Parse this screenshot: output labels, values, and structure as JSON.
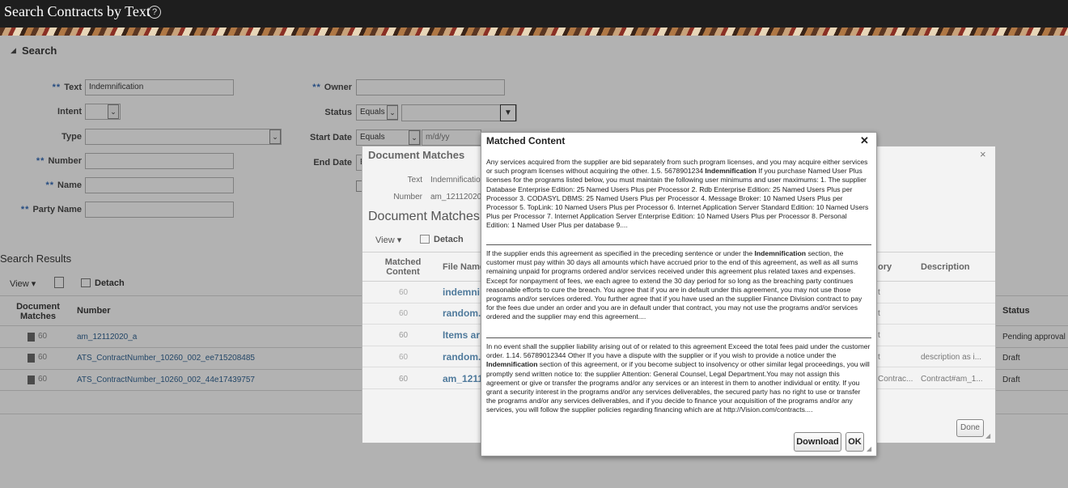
{
  "header": {
    "title": "Search Contracts by Text",
    "help_icon": "?"
  },
  "search": {
    "section_title": "Search",
    "req_marker": "**",
    "text_label": "Text",
    "text_value": "Indemnification",
    "intent_label": "Intent",
    "type_label": "Type",
    "number_label": "Number",
    "name_label": "Name",
    "party_label": "Party Name",
    "owner_label": "Owner",
    "status_label": "Status",
    "status_op": "Equals",
    "start_label": "Start Date",
    "start_op": "Equals",
    "start_placeholder": "m/d/yy",
    "end_label": "End Date",
    "end_op_partial": "E"
  },
  "results": {
    "title": "Search Results",
    "view_label": "View",
    "detach_label": "Detach",
    "col_doc_matches": "Document Matches",
    "col_number": "Number",
    "col_status": "Status",
    "rows": [
      {
        "number": "am_12112020_a",
        "status": "Pending approval"
      },
      {
        "number": "ATS_ContractNumber_10260_002_ee715208485",
        "status": "Draft"
      },
      {
        "number": "ATS_ContractNumber_10260_002_44e17439757",
        "status": "Draft"
      }
    ]
  },
  "doc_dialog": {
    "title": "Document Matches",
    "text_label": "Text",
    "text_value": "Indemnification",
    "number_label": "Number",
    "number_value": "am_12112020_",
    "sub_title": "Document Matches",
    "view_label": "View",
    "detach_label": "Detach",
    "col_matched": "Matched Content",
    "col_file": "File Name",
    "col_category_partial": "ory",
    "col_description": "Description",
    "rows": [
      {
        "file": "indemni",
        "cat": "t",
        "desc": ""
      },
      {
        "file": "random.",
        "cat": "t",
        "desc": ""
      },
      {
        "file": "Items ar",
        "cat": "t",
        "desc": ""
      },
      {
        "file": "random.",
        "cat": "t",
        "desc": "description as i..."
      },
      {
        "file": "am_1211",
        "cat": "Contrac...",
        "desc": "Contract#am_1..."
      }
    ],
    "done_label": "Done"
  },
  "match_dialog": {
    "title": "Matched Content",
    "close_icon": "✕",
    "paragraphs": [
      {
        "before": "Any services acquired from the supplier are bid separately from such program licenses, and you may acquire either services or such program licenses without acquiring the other. 1.5. 5678901234 ",
        "bold": "Indemnification",
        "after": " If you purchase Named User Plus licenses for the programs listed below, you must maintain the following user minimums and user maximums: 1. The supplier Database Enterprise Edition: 25 Named Users Plus per Processor 2. Rdb Enterprise Edition: 25 Named Users Plus per Processor 3. CODASYL DBMS: 25 Named Users Plus per Processor 4. Message Broker: 10 Named Users Plus per Processor 5. TopLink: 10 Named Users Plus per Processor 6. Internet Application Server Standard Edition: 10 Named Users Plus per Processor 7. Internet Application Server Enterprise Edition: 10 Named Users Plus per Processor 8. Personal Edition: 1 Named User Plus per database 9...."
      },
      {
        "before": "If the supplier ends this agreement as specified in the preceding sentence or under the ",
        "bold": "Indemnification",
        "after": " section, the customer must pay within 30 days all amounts which have accrued prior to the end of this agreement, as well as all sums remaining unpaid for programs ordered and/or services received under this agreement plus related taxes and expenses. Except for nonpayment of fees, we each agree to extend the 30 day period for so long as the breaching party continues reasonable efforts to cure the breach. You agree that if you are in default under this agreement, you may not use those programs and/or services ordered. You further agree that if you have used an the supplier Finance Division contract to pay for the fees due under an order and you are in default under that contract, you may not use the programs and/or services ordered and the supplier may end this agreement...."
      },
      {
        "before": "In no event shall the supplier liability arising out of or related to this agreement Exceed the total fees paid under the customer order. 1.14. 56789012344 Other If you have a dispute with the supplier or if you wish to provide a notice under the ",
        "bold": "Indemnification",
        "after": " section of this agreement, or if you become subject to insolvency or other similar legal proceedings, you will promptly send written notice to: the supplier Attention: General Counsel, Legal Department.You may not assign this agreement or give or transfer the programs and/or any services or an interest in them to another individual or entity. If you grant a security interest in the programs and/or any services deliverables, the secured party has no right to use or transfer the programs and/or any services deliverables, and if you decide to finance your acquisition of the programs and/or any services, you will follow the supplier policies regarding financing which are at http://Vision.com/contracts...."
      }
    ],
    "download_label": "Download",
    "ok_label": "OK"
  }
}
